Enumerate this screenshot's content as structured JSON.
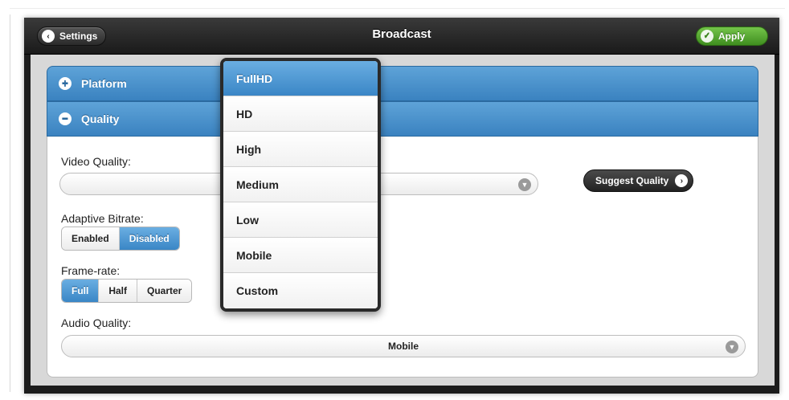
{
  "header": {
    "title": "Broadcast",
    "back_label": "Settings",
    "back_icon": "chevron-left-icon",
    "apply_label": "Apply",
    "apply_icon": "check-icon"
  },
  "sections": {
    "platform": {
      "label": "Platform",
      "icon": "plus-icon"
    },
    "quality": {
      "label": "Quality",
      "icon": "minus-icon"
    }
  },
  "form": {
    "video_quality_label": "Video Quality:",
    "video_quality_value": "",
    "suggest_label": "Suggest Quality",
    "adaptive_label": "Adaptive Bitrate:",
    "adaptive_options": [
      "Enabled",
      "Disabled"
    ],
    "adaptive_selected": "Disabled",
    "framerate_label": "Frame-rate:",
    "framerate_options": [
      "Full",
      "Half",
      "Quarter"
    ],
    "framerate_selected": "Full",
    "audio_quality_label": "Audio Quality:",
    "audio_quality_value": "Mobile"
  },
  "dropdown": {
    "items": [
      "FullHD",
      "HD",
      "High",
      "Medium",
      "Low",
      "Mobile",
      "Custom"
    ],
    "selected": "FullHD"
  },
  "colors": {
    "accent_blue": "#3a86c6",
    "apply_green": "#4fa52a",
    "header_dark": "#1c1c1c"
  }
}
